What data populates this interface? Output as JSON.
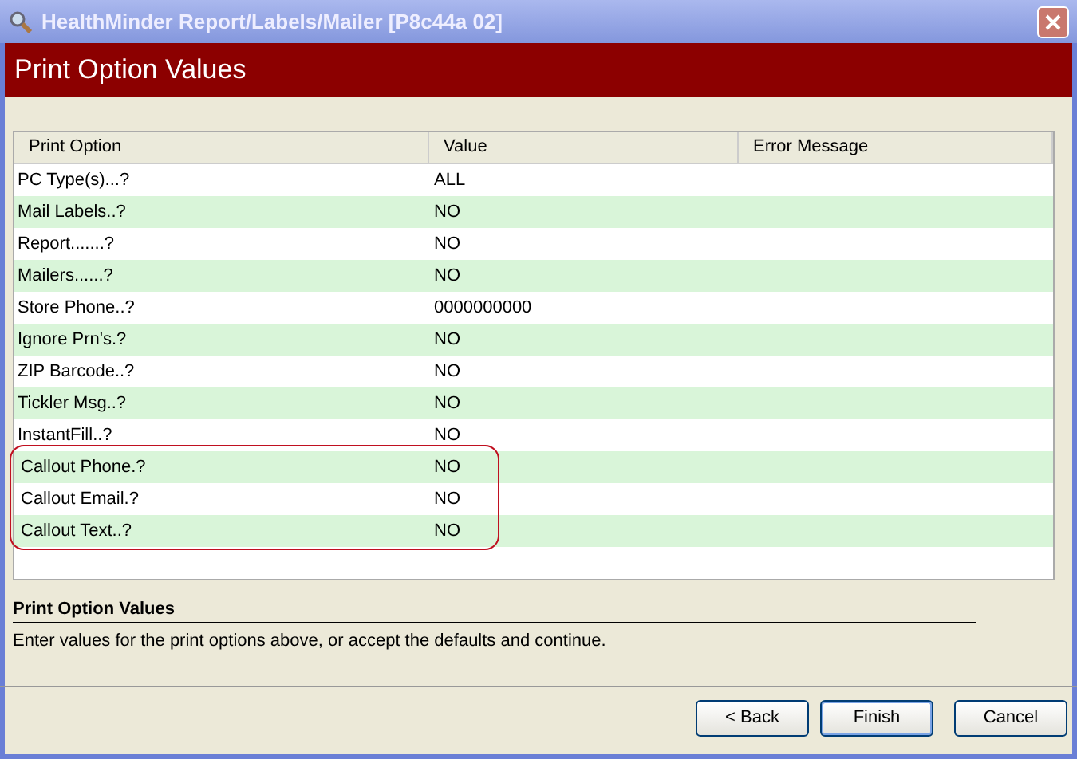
{
  "window": {
    "title": "HealthMinder Report/Labels/Mailer [P8c44a 02]"
  },
  "header": {
    "title": "Print Option Values"
  },
  "table": {
    "columns": [
      "Print Option",
      "Value",
      "Error Message"
    ],
    "rows": [
      {
        "option": "PC Type(s)...?",
        "value": "ALL",
        "highlighted": false
      },
      {
        "option": "Mail Labels..?",
        "value": "NO",
        "highlighted": false
      },
      {
        "option": "Report.......?",
        "value": "NO",
        "highlighted": false
      },
      {
        "option": "Mailers......?",
        "value": "NO",
        "highlighted": false
      },
      {
        "option": "Store Phone..?",
        "value": "0000000000",
        "highlighted": false
      },
      {
        "option": "Ignore Prn's.?",
        "value": "NO",
        "highlighted": false
      },
      {
        "option": "ZIP Barcode..?",
        "value": "NO",
        "highlighted": false
      },
      {
        "option": "Tickler Msg..?",
        "value": "NO",
        "highlighted": false
      },
      {
        "option": "InstantFill..?",
        "value": "NO",
        "highlighted": false
      },
      {
        "option": "Callout Phone.?",
        "value": "NO",
        "highlighted": true
      },
      {
        "option": "Callout Email.?",
        "value": "NO",
        "highlighted": true
      },
      {
        "option": "Callout Text..?",
        "value": "NO",
        "highlighted": true
      }
    ]
  },
  "help": {
    "title": "Print Option Values",
    "text": "Enter values for the print options above, or accept the defaults and continue."
  },
  "buttons": [
    "< Back",
    "Finish",
    "Cancel"
  ]
}
